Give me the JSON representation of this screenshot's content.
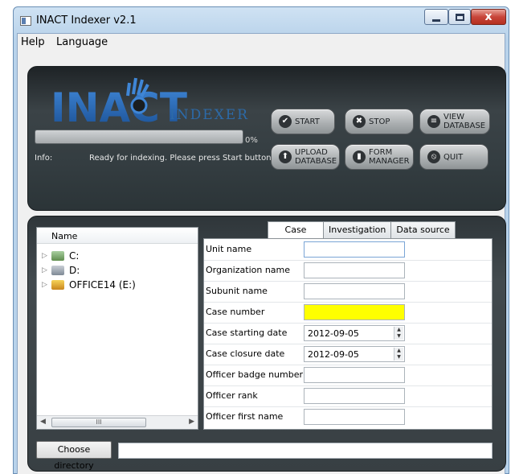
{
  "window": {
    "title": "INACT Indexer v2.1",
    "close_glyph": "x"
  },
  "menu": {
    "help": "Help",
    "language": "Language"
  },
  "logo": {
    "brand": "INACT",
    "indexer": "INDEXER"
  },
  "progress": {
    "value": 0,
    "label": "0%"
  },
  "info": {
    "label": "Info:",
    "text": "Ready for indexing. Please press Start button."
  },
  "buttons": {
    "start": "START",
    "stop": "STOP",
    "view_line1": "VIEW",
    "view_line2": "DATABASE",
    "upload_line1": "UPLOAD",
    "upload_line2": "DATABASE",
    "form_line1": "FORM",
    "form_line2": "MANAGER",
    "quit": "QUIT"
  },
  "tree": {
    "header": "Name",
    "items": [
      {
        "label": "C:",
        "icon": "drive-c-icon"
      },
      {
        "label": "D:",
        "icon": "drive-d-icon"
      },
      {
        "label": "OFFICE14 (E:)",
        "icon": "drive-e-icon"
      }
    ],
    "scroll_thumb": "III"
  },
  "tabs": [
    "Case",
    "Investigation",
    "Data source"
  ],
  "form": {
    "rows": [
      {
        "label": "Unit name",
        "value": ""
      },
      {
        "label": "Organization name",
        "value": ""
      },
      {
        "label": "Subunit name",
        "value": ""
      },
      {
        "label": "Case number",
        "value": ""
      },
      {
        "label": "Case starting date",
        "value": "2012-09-05"
      },
      {
        "label": "Case closure date",
        "value": "2012-09-05"
      },
      {
        "label": "Officer badge number",
        "value": ""
      },
      {
        "label": "Officer rank",
        "value": ""
      },
      {
        "label": "Officer first name",
        "value": ""
      }
    ]
  },
  "footer": {
    "choose_directory": "Choose directory",
    "directory_value": ""
  },
  "colors": {
    "accent_yellow": "#ffff00",
    "logo_blue": "#2c6aa8"
  }
}
